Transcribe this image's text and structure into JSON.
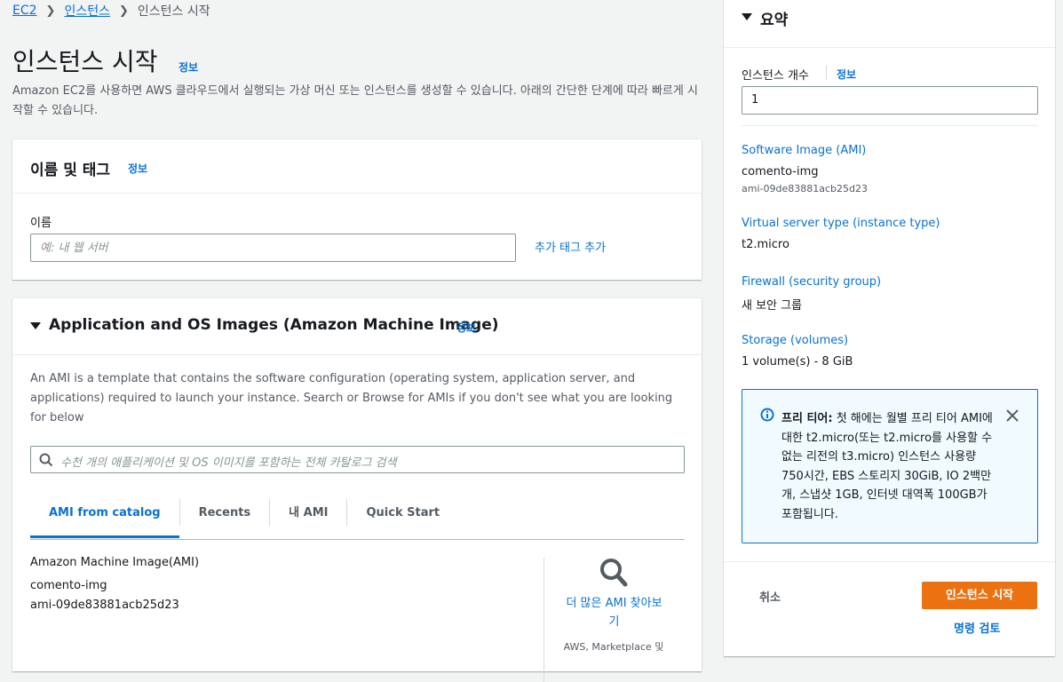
{
  "breadcrumb": {
    "ec2": "EC2",
    "instances": "인스턴스",
    "current": "인스턴스 시작"
  },
  "page": {
    "title": "인스턴스 시작",
    "info": "정보",
    "description": "Amazon EC2를 사용하면 AWS 클라우드에서 실행되는 가상 머신 또는 인스턴스를 생성할 수 있습니다. 아래의 간단한 단계에 따라 빠르게 시작할 수 있습니다."
  },
  "name_panel": {
    "title": "이름 및 태그",
    "info": "정보",
    "name_label": "이름",
    "name_placeholder": "예: 내 웹 서버",
    "add_tags": "추가 태그 추가"
  },
  "ami_panel": {
    "title": "Application and OS Images (Amazon Machine Image)",
    "info": "정보",
    "description": "An AMI is a template that contains the software configuration (operating system, application server, and applications) required to launch your instance. Search or Browse for AMIs if you don't see what you are looking for below",
    "search_placeholder": "수천 개의 애플리케이션 및 OS 이미지를 포함하는 전체 카탈로그 검색",
    "tabs": [
      "AMI from catalog",
      "Recents",
      "내 AMI",
      "Quick Start"
    ],
    "selected_label": "Amazon Machine Image(AMI)",
    "selected_name": "comento-img",
    "selected_id": "ami-09de83881acb25d23",
    "more_amis_line1": "더 많은 AMI 찾아보",
    "more_amis_line2": "기",
    "more_amis_sub": "AWS, Marketplace 및"
  },
  "summary": {
    "title": "요약",
    "count_label": "인스턴스 개수",
    "count_info": "정보",
    "count_value": "1",
    "ami_label": "Software Image (AMI)",
    "ami_name": "comento-img",
    "ami_id": "ami-09de83881acb25d23",
    "type_label": "Virtual server type (instance type)",
    "type_value": "t2.micro",
    "fw_label": "Firewall (security group)",
    "fw_value": "새 보안 그룹",
    "storage_label": "Storage (volumes)",
    "storage_value": "1 volume(s) - 8 GiB",
    "alert_title": "프리 티어:",
    "alert_body": "첫 해에는 월별 프리 티어 AMI에 대한 t2.micro(또는 t2.micro를 사용할 수 없는 리전의 t3.micro) 인스턴스 사용량 750시간, EBS 스토리지 30GiB, IO 2백만 개, 스냅샷 1GB, 인터넷 대역폭 100GB가 포함됩니다.",
    "cancel": "취소",
    "launch": "인스턴스 시작",
    "review": "명령 검토"
  },
  "colors": {
    "accent": "#0972d3",
    "primary_button": "#ec7211"
  }
}
